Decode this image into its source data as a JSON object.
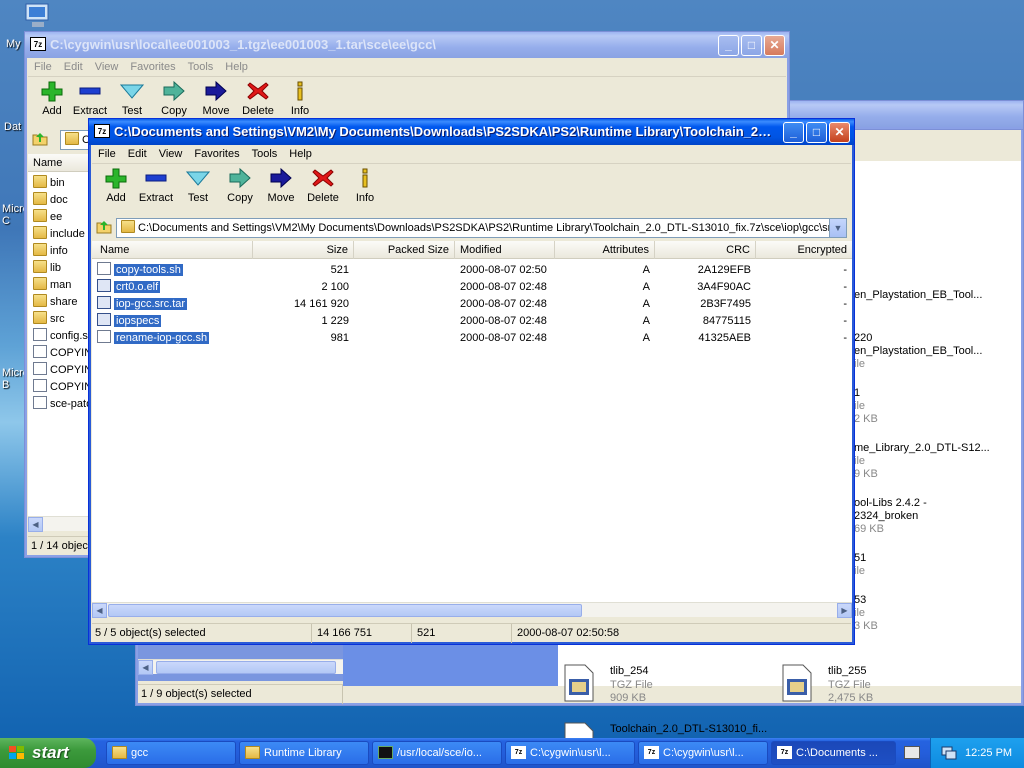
{
  "desktop": {
    "icons": [
      "My",
      "Dat",
      "Micro C",
      "Micro B"
    ]
  },
  "bg_window1": {
    "files": [
      {
        "name": "en_Playstation_EB_Tool...",
        "type": ""
      },
      {
        "name": "220",
        "type": ""
      },
      {
        "name": "en_Playstation_EB_Tool...",
        "type": "ile"
      },
      {
        "name": "1",
        "type": "ile"
      },
      {
        "name": "",
        "type": "2 KB"
      },
      {
        "name": "me_Library_2.0_DTL-S12...",
        "type": ""
      },
      {
        "name": "",
        "type": "ile"
      },
      {
        "name": "",
        "type": "9 KB"
      },
      {
        "name": "ool-Libs 2.4.2 -",
        "type": ""
      },
      {
        "name": "2324_broken",
        "type": ""
      },
      {
        "name": "",
        "type": "69 KB"
      },
      {
        "name": "51",
        "type": ""
      },
      {
        "name": "",
        "type": "ile"
      },
      {
        "name": "53",
        "type": ""
      },
      {
        "name": "",
        "type": "ile"
      },
      {
        "name": "",
        "type": "3 KB"
      }
    ],
    "tlib_254": {
      "name": "tlib_254",
      "type": "TGZ File",
      "size": "909 KB"
    },
    "tlib_255": {
      "name": "tlib_255",
      "type": "TGZ File",
      "size": "2,475 KB"
    },
    "toolchain": {
      "name": "Toolchain_2.0_DTL-S13010_fi...",
      "type": "7Z File"
    },
    "status": "1 / 9 object(s) selected"
  },
  "win_back": {
    "title": "C:\\cygwin\\usr\\local\\ee001003_1.tgz\\ee001003_1.tar\\sce\\ee\\gcc\\",
    "menu": [
      "File",
      "Edit",
      "View",
      "Favorites",
      "Tools",
      "Help"
    ],
    "tools": [
      "Add",
      "Extract",
      "Test",
      "Copy",
      "Move",
      "Delete",
      "Info"
    ],
    "col_name": "Name",
    "address": "C",
    "items": [
      "bin",
      "doc",
      "ee",
      "include",
      "info",
      "lib",
      "man",
      "share",
      "src",
      "config.s",
      "COPYIN",
      "COPYIN",
      "COPYIN",
      "sce-pato"
    ],
    "status": "1 / 14 object"
  },
  "win_front": {
    "title": "C:\\Documents and Settings\\VM2\\My Documents\\Downloads\\PS2SDKA\\PS2\\Runtime Library\\Toolchain_2.0...",
    "menu": [
      "File",
      "Edit",
      "View",
      "Favorites",
      "Tools",
      "Help"
    ],
    "tools": [
      "Add",
      "Extract",
      "Test",
      "Copy",
      "Move",
      "Delete",
      "Info"
    ],
    "address": "C:\\Documents and Settings\\VM2\\My Documents\\Downloads\\PS2SDKA\\PS2\\Runtime Library\\Toolchain_2.0_DTL-S13010_fix.7z\\sce\\iop\\gcc\\src\\",
    "columns": {
      "name": "Name",
      "size": "Size",
      "packed": "Packed Size",
      "modified": "Modified",
      "attributes": "Attributes",
      "crc": "CRC",
      "encrypted": "Encrypted"
    },
    "files": [
      {
        "name": "copy-tools.sh",
        "size": "521",
        "packed": "",
        "modified": "2000-08-07 02:50",
        "attr": "A",
        "crc": "2A129EFB",
        "enc": "-"
      },
      {
        "name": "crt0.o.elf",
        "size": "2 100",
        "packed": "",
        "modified": "2000-08-07 02:48",
        "attr": "A",
        "crc": "3A4F90AC",
        "enc": "-"
      },
      {
        "name": "iop-gcc.src.tar",
        "size": "14 161 920",
        "packed": "",
        "modified": "2000-08-07 02:48",
        "attr": "A",
        "crc": "2B3F7495",
        "enc": "-"
      },
      {
        "name": "iopspecs",
        "size": "1 229",
        "packed": "",
        "modified": "2000-08-07 02:48",
        "attr": "A",
        "crc": "84775115",
        "enc": "-"
      },
      {
        "name": "rename-iop-gcc.sh",
        "size": "981",
        "packed": "",
        "modified": "2000-08-07 02:48",
        "attr": "A",
        "crc": "41325AEB",
        "enc": "-"
      }
    ],
    "status": {
      "selected": "5 / 5 object(s) selected",
      "size": "14 166 751",
      "packed": "521",
      "modified": "2000-08-07 02:50:58"
    }
  },
  "taskbar": {
    "start": "start",
    "tasks": [
      "gcc",
      "Runtime Library",
      "/usr/local/sce/io...",
      "C:\\cygwin\\usr\\l...",
      "C:\\cygwin\\usr\\l...",
      "C:\\Documents ..."
    ],
    "clock": "12:25 PM"
  },
  "colors": {
    "selection": "#316ac5",
    "titlebar": "#0054e3",
    "start": "#3c9a3c"
  }
}
